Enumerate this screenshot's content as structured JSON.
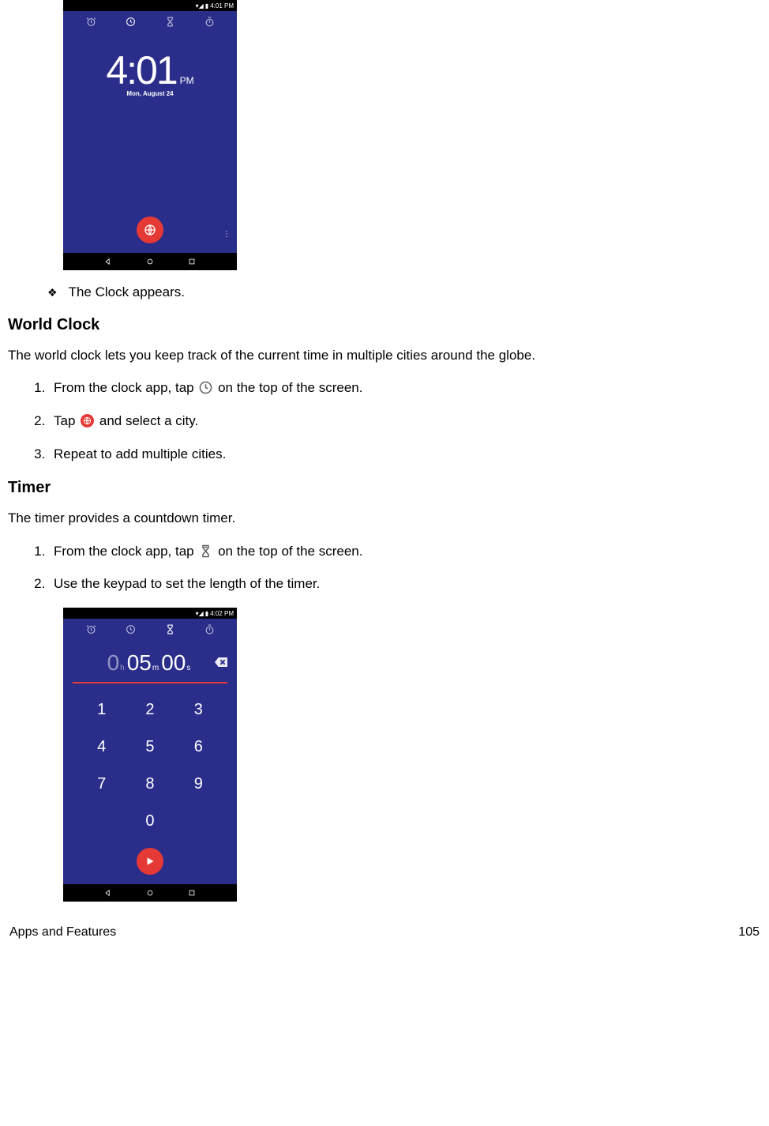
{
  "screenshot1": {
    "status_time": "4:01 PM",
    "time": "4:01",
    "ampm": "PM",
    "date": "Mon, August 24"
  },
  "bullet1": "The Clock appears.",
  "section_world_clock": {
    "heading": "World Clock",
    "intro": "The world clock lets you keep track of the current time in multiple cities around the globe.",
    "step1_a": "From the clock app, tap ",
    "step1_b": " on the top of the screen.",
    "step2_a": "Tap ",
    "step2_b": " and select a city.",
    "step3": "Repeat to add multiple cities."
  },
  "section_timer": {
    "heading": "Timer",
    "intro": "The timer provides a countdown timer.",
    "step1_a": "From the clock app, tap ",
    "step1_b": " on the top of the screen.",
    "step2": "Use the keypad to set the length of the timer."
  },
  "screenshot2": {
    "status_time": "4:02 PM",
    "h": "0",
    "m": "05",
    "s": "00",
    "keys": [
      "1",
      "2",
      "3",
      "4",
      "5",
      "6",
      "7",
      "8",
      "9",
      "0"
    ]
  },
  "footer": {
    "left": "Apps and Features",
    "right": "105"
  }
}
